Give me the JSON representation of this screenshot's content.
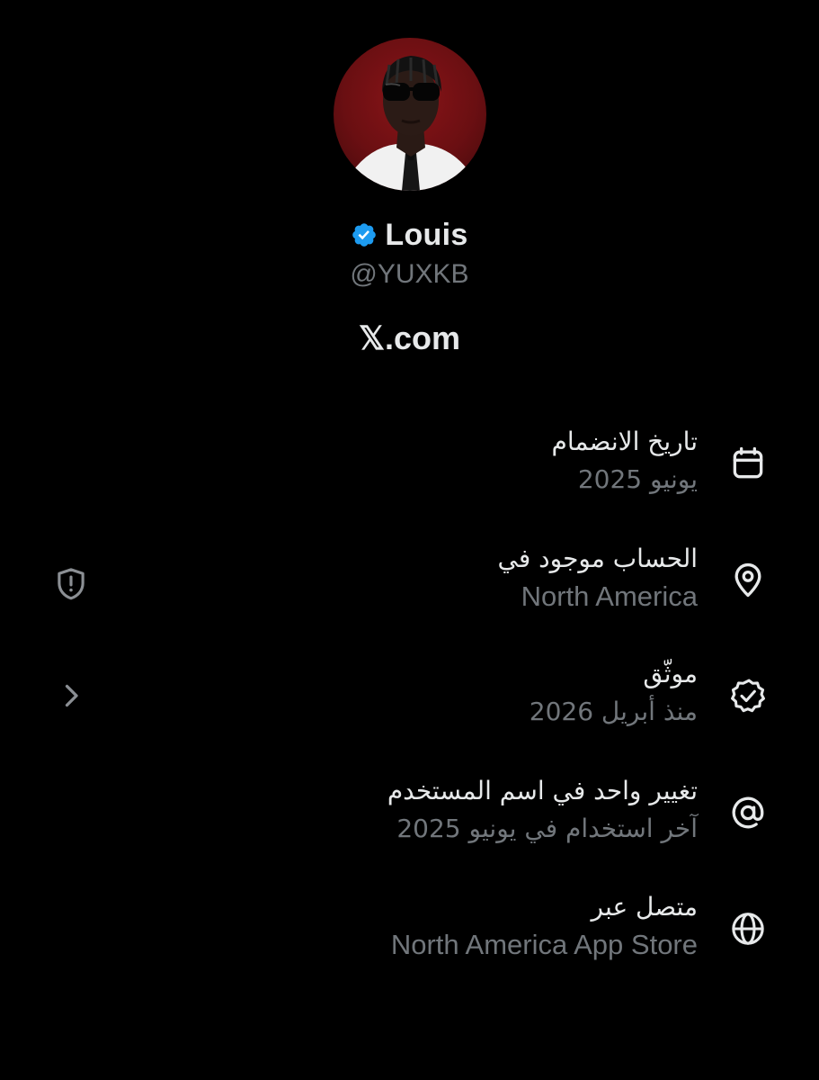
{
  "profile": {
    "display_name": "Louis",
    "handle": "@YUXKB",
    "website": "𝕏.com",
    "verified": true,
    "avatar": "profile-photo"
  },
  "colors": {
    "background": "#000000",
    "primary_text": "#e7e9ea",
    "secondary_text": "#71767b",
    "verified_blue": "#1d9bf0"
  },
  "about": {
    "rows": [
      {
        "icon": "calendar-icon",
        "title": "تاريخ الانضمام",
        "subtitle": "يونيو 2025"
      },
      {
        "icon": "location-pin-icon",
        "title": "الحساب موجود في",
        "subtitle": "North America",
        "action_icon": "shield-alert-icon"
      },
      {
        "icon": "verified-check-icon",
        "title": "موثّق",
        "subtitle": "منذ أبريل 2026",
        "action_icon": "chevron-right-icon"
      },
      {
        "icon": "at-sign-icon",
        "title": "تغيير واحد في اسم المستخدم",
        "subtitle": "آخر استخدام في يونيو 2025"
      },
      {
        "icon": "globe-icon",
        "title": "متصل عبر",
        "subtitle": "North America App Store"
      }
    ]
  }
}
